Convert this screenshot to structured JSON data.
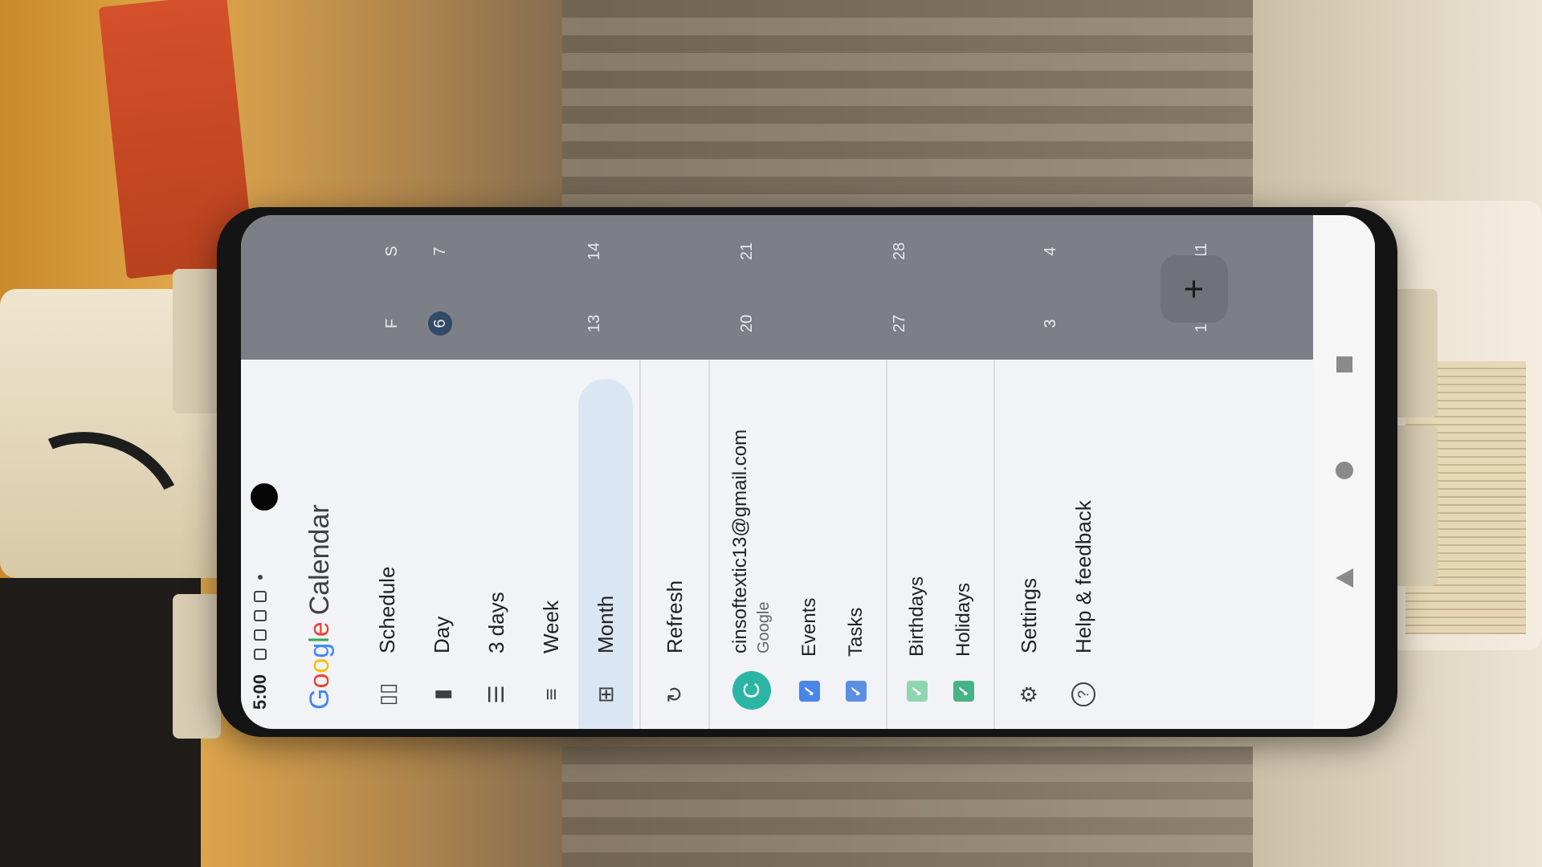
{
  "status": {
    "time": "5:00"
  },
  "app": {
    "logo": [
      "G",
      "o",
      "o",
      "g",
      "l",
      "e"
    ],
    "logo_colors": [
      "#4285F4",
      "#EA4335",
      "#FBBC05",
      "#4285F4",
      "#34A853",
      "#EA4335"
    ],
    "title": "Calendar"
  },
  "views": [
    {
      "label": "Schedule",
      "icon": "schedule-icon",
      "glyph": "▯▯"
    },
    {
      "label": "Day",
      "icon": "day-icon",
      "glyph": "▮"
    },
    {
      "label": "3 days",
      "icon": "three-days-icon",
      "glyph": "☰"
    },
    {
      "label": "Week",
      "icon": "week-icon",
      "glyph": "≡"
    },
    {
      "label": "Month",
      "icon": "month-icon",
      "glyph": "⊞",
      "active": true
    }
  ],
  "refresh": {
    "label": "Refresh",
    "glyph": "↻"
  },
  "account": {
    "initial": "C",
    "email": "cinsoftextic13@gmail.com",
    "provider": "Google"
  },
  "calendars": [
    {
      "label": "Events",
      "color": "#4a86e8"
    },
    {
      "label": "Tasks",
      "color": "#5b8fe0"
    },
    {
      "label": "Birthdays",
      "color": "#8fd6b0"
    },
    {
      "label": "Holidays",
      "color": "#45b386"
    }
  ],
  "settings": {
    "label": "Settings",
    "glyph": "⚙"
  },
  "help": {
    "label": "Help & feedback",
    "glyph": "?"
  },
  "calendar_bg": {
    "day_headers": [
      "F",
      "S"
    ],
    "weeks": [
      [
        "6",
        "7"
      ],
      [
        "13",
        "14"
      ],
      [
        "20",
        "21"
      ],
      [
        "27",
        "28"
      ],
      [
        "3",
        "4"
      ],
      [
        "10",
        "11"
      ]
    ],
    "today": "6",
    "profile_initial": "C"
  },
  "fab": {
    "label": "+"
  }
}
